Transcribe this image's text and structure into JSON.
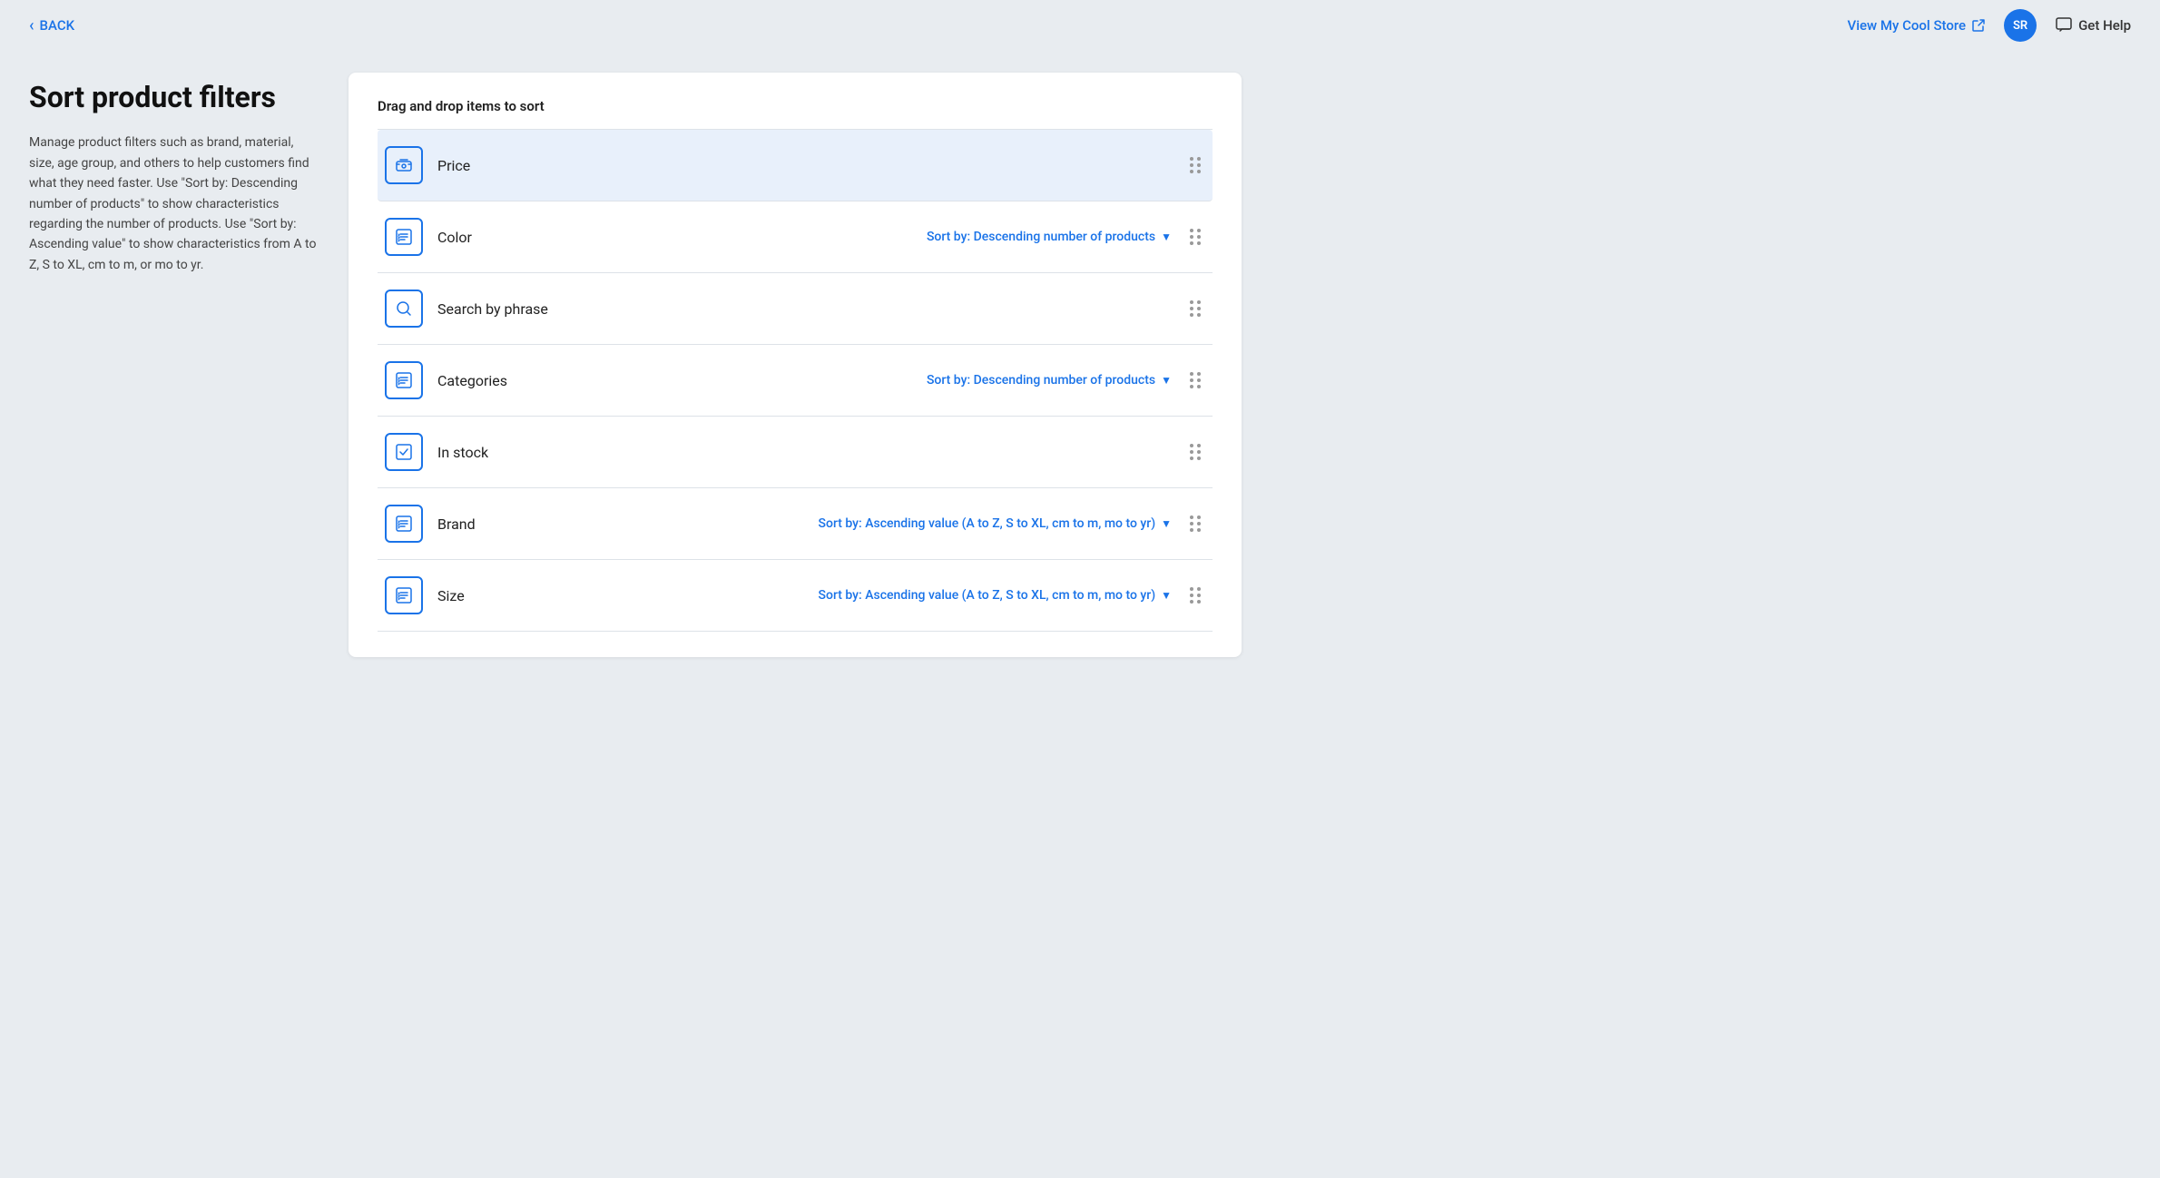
{
  "nav": {
    "back_label": "BACK",
    "view_store_label": "View My Cool Store",
    "avatar_initials": "SR",
    "get_help_label": "Get Help"
  },
  "page": {
    "title": "Sort product filters",
    "description": "Manage product filters such as brand, material, size, age group, and others to help customers find what they need faster. Use \"Sort by: Descending number of products\" to show characteristics regarding the number of products. Use \"Sort by: Ascending value\" to show characteristics from A to Z, S to XL, cm to m, or mo to yr."
  },
  "filters_section": {
    "drag_drop_label": "Drag and drop items to sort",
    "filters": [
      {
        "name": "Price",
        "icon_type": "price",
        "sort_option": null,
        "highlighted": true
      },
      {
        "name": "Color",
        "icon_type": "list",
        "sort_option": "Sort by: Descending number of products",
        "highlighted": false
      },
      {
        "name": "Search by phrase",
        "icon_type": "search",
        "sort_option": null,
        "highlighted": false
      },
      {
        "name": "Categories",
        "icon_type": "list",
        "sort_option": "Sort by: Descending number of products",
        "highlighted": false
      },
      {
        "name": "In stock",
        "icon_type": "checkbox",
        "sort_option": null,
        "highlighted": false
      },
      {
        "name": "Brand",
        "icon_type": "list",
        "sort_option": "Sort by: Ascending value (A to Z, S to XL, cm to m, mo to yr)",
        "highlighted": false
      },
      {
        "name": "Size",
        "icon_type": "list",
        "sort_option": "Sort by: Ascending value (A to Z, S to XL, cm to m, mo to yr)",
        "highlighted": false
      }
    ]
  }
}
